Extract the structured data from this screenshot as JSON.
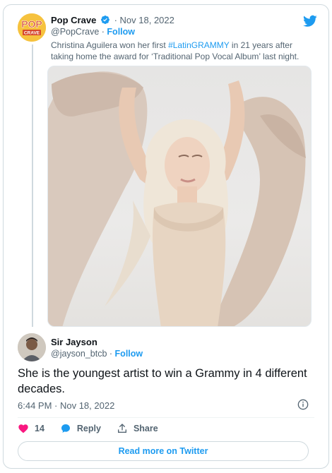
{
  "parent_tweet": {
    "author_name": "Pop Crave",
    "date": "Nov 18, 2022",
    "handle": "@PopCrave",
    "follow_label": "Follow",
    "separator": "·",
    "text_before": "Christina Aguilera won her first ",
    "hashtag": "#LatinGRAMMY",
    "text_after": " in 21 years after taking home the award for ‘Traditional Pop Vocal Album’ last night.",
    "avatar_logo": {
      "line1": "POP",
      "line2": "CRAVE"
    }
  },
  "reply_tweet": {
    "author_name": "Sir Jayson",
    "handle": "@jayson_btcb",
    "follow_label": "Follow",
    "separator": "·",
    "text": "She is the youngest artist to win a Grammy in 4 different decades.",
    "timestamp": "6:44 PM · Nov 18, 2022"
  },
  "actions": {
    "like_count": "14",
    "reply_label": "Reply",
    "share_label": "Share"
  },
  "read_more_label": "Read more on Twitter",
  "colors": {
    "accent": "#1d9bf0",
    "like": "#f91880",
    "muted": "#536471",
    "border": "#cfd9de"
  }
}
